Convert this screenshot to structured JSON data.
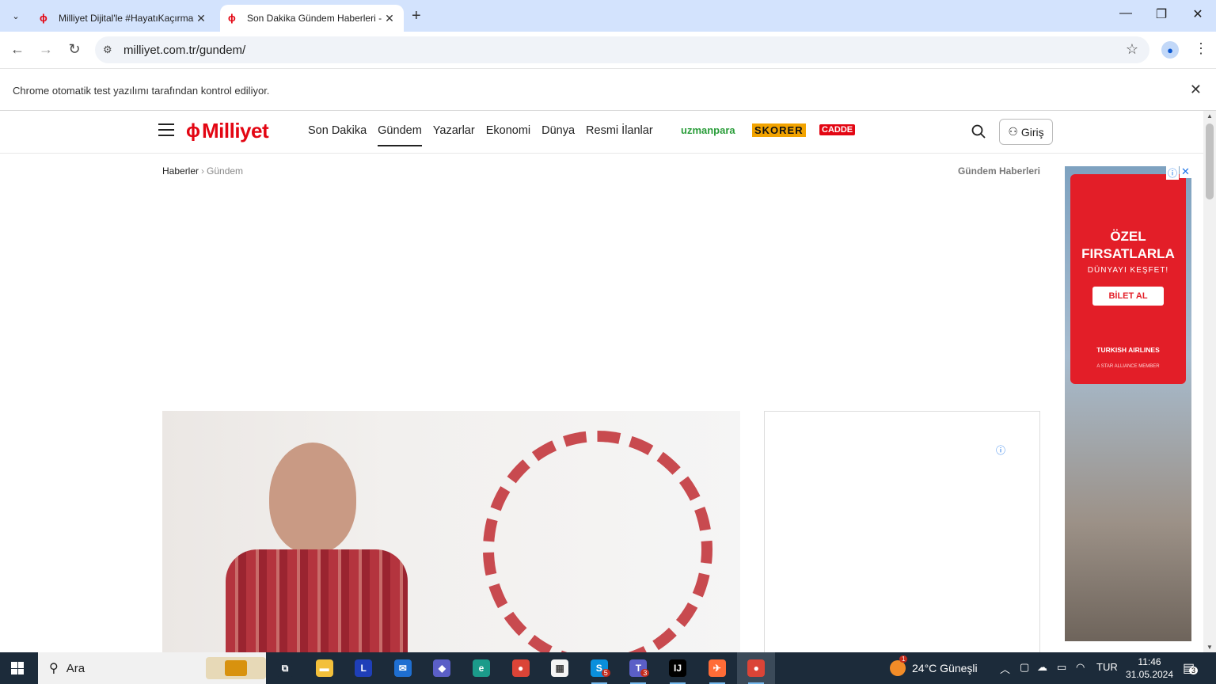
{
  "browser": {
    "tabs": [
      {
        "title": "Milliyet Dijital'le #HayatıKaçırma",
        "active": false
      },
      {
        "title": "Son Dakika Gündem Haberleri - ",
        "active": true
      }
    ],
    "url": "milliyet.com.tr/gundem/",
    "infobar_text": "Chrome otomatik test yazılımı tarafından kontrol ediliyor.",
    "window_controls": [
      "—",
      "❐",
      "✕"
    ]
  },
  "site": {
    "logo_text": "Milliyet",
    "nav": [
      {
        "label": "Son Dakika",
        "active": false
      },
      {
        "label": "Gündem",
        "active": true
      },
      {
        "label": "Yazarlar",
        "active": false
      },
      {
        "label": "Ekonomi",
        "active": false
      },
      {
        "label": "Dünya",
        "active": false
      },
      {
        "label": "Resmi İlanlar",
        "active": false
      }
    ],
    "brands": {
      "uzmanpara": "uzmanpara",
      "skorer": "SKORER",
      "cadde": "CADDE"
    },
    "login_label": "Giriş",
    "breadcrumb": {
      "root": "Haberler",
      "current": "Gündem"
    },
    "section_link": "Gündem Haberleri"
  },
  "ad": {
    "headline_1": "ÖZEL",
    "headline_2": "FIRSATLARLA",
    "subline": "DÜNYAYI KEŞFET!",
    "cta": "BİLET AL",
    "brand": "TURKISH AIRLINES",
    "alliance": "A STAR ALLIANCE MEMBER"
  },
  "taskbar": {
    "search_placeholder": "Ara",
    "apps": [
      {
        "name": "task-view",
        "glyph": "⧉",
        "color": "#1c2b3a"
      },
      {
        "name": "file-explorer",
        "glyph": "▬",
        "color": "#f3c03b"
      },
      {
        "name": "l-app",
        "glyph": "L",
        "color": "#1f3fb8"
      },
      {
        "name": "mail",
        "glyph": "✉",
        "color": "#1f6fd1"
      },
      {
        "name": "copilot",
        "glyph": "◆",
        "color": "#5b5fc7"
      },
      {
        "name": "edge",
        "glyph": "e",
        "color": "#1b9b8a"
      },
      {
        "name": "chrome",
        "glyph": "●",
        "color": "#db4437"
      },
      {
        "name": "store",
        "glyph": "▦",
        "color": "#f4f4f4"
      },
      {
        "name": "skype",
        "glyph": "S",
        "color": "#0a8fdc",
        "badge": "5"
      },
      {
        "name": "teams",
        "glyph": "T",
        "color": "#5b5fc7",
        "badge": "3"
      },
      {
        "name": "intellij",
        "glyph": "IJ",
        "color": "#000000"
      },
      {
        "name": "postman",
        "glyph": "✈",
        "color": "#ff6c37"
      },
      {
        "name": "chrome-active",
        "glyph": "●",
        "color": "#db4437"
      }
    ],
    "weather": "24°C  Güneşli",
    "weather_badge": "1",
    "lang": "TUR",
    "time": "11:46",
    "date": "31.05.2024",
    "notif_count": "3"
  }
}
